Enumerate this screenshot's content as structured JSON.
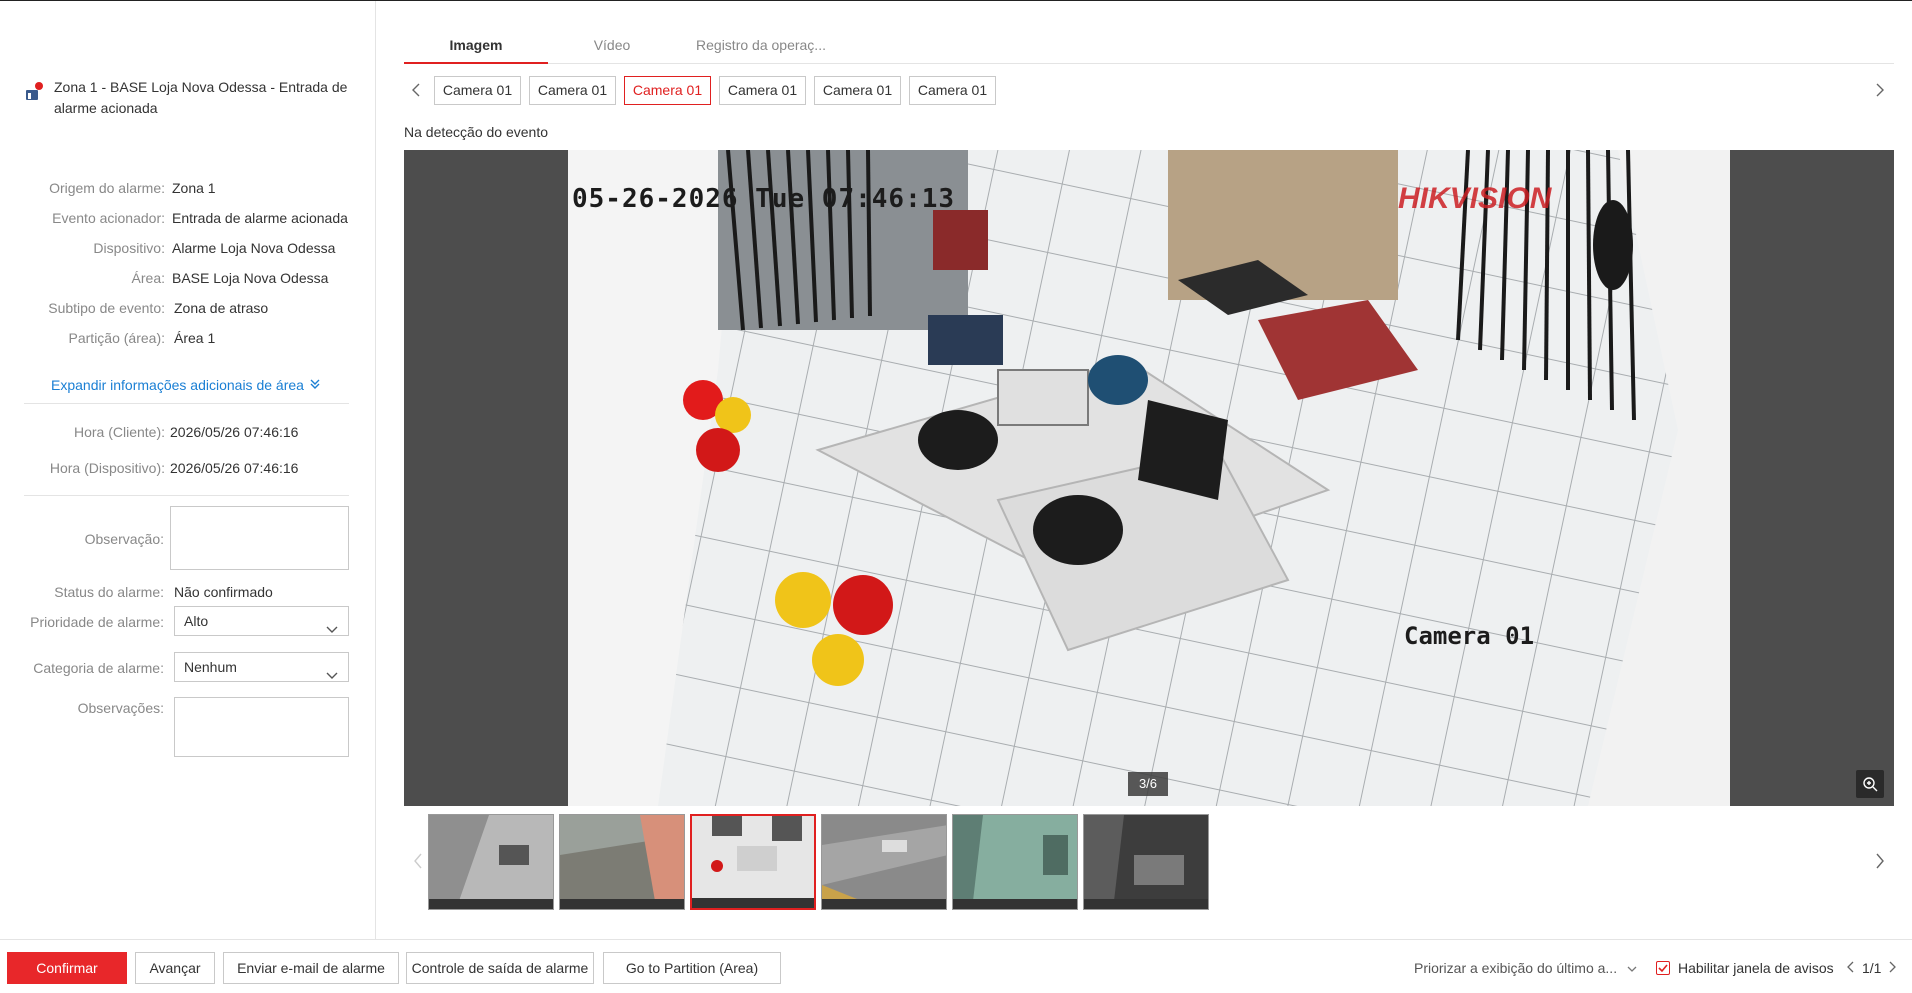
{
  "alarm": {
    "title": "Zona 1 - BASE Loja Nova Odessa - Entrada de alarme acionada"
  },
  "details": [
    {
      "label": "Origem do alarme:",
      "value": "Zona 1"
    },
    {
      "label": "Evento acionador:",
      "value": "Entrada de alarme acionada"
    },
    {
      "label": "Dispositivo:",
      "value": "Alarme Loja Nova Odessa"
    },
    {
      "label": "Área:",
      "value": "BASE Loja Nova Odessa"
    },
    {
      "label": "Subtipo de evento:",
      "value": "Zona de atraso"
    },
    {
      "label": "Partição (área):",
      "value": "Área 1"
    }
  ],
  "expand_label": "Expandir informações adicionais de área",
  "times": [
    {
      "label": "Hora (Cliente):",
      "value": "2026/05/26 07:46:16"
    },
    {
      "label": "Hora (Dispositivo):",
      "value": "2026/05/26 07:46:16"
    }
  ],
  "form": {
    "observation_label": "Observação:",
    "status_label": "Status do alarme:",
    "status_value": "Não confirmado",
    "priority_label": "Prioridade de alarme:",
    "priority_value": "Alto",
    "category_label": "Categoria de alarme:",
    "category_value": "Nenhum",
    "notes_label": "Observações:"
  },
  "tabs": [
    {
      "label": "Imagem",
      "active": true
    },
    {
      "label": "Vídeo",
      "active": false
    },
    {
      "label": "Registro da operaç...",
      "active": false
    }
  ],
  "cameras": [
    "Camera 01",
    "Camera 01",
    "Camera 01",
    "Camera 01",
    "Camera 01",
    "Camera 01"
  ],
  "selected_camera_index": 2,
  "event_label": "Na detecção do evento",
  "image": {
    "osd_time": "05-26-2026 Tue 07:46:13",
    "osd_brand": "HIKVISION",
    "osd_camera": "Camera 01",
    "counter": "3/6"
  },
  "thumbnails_selected_index": 2,
  "colors": {
    "accent": "#e8272a",
    "link": "#1a7fd4"
  },
  "footer": {
    "confirm": "Confirmar",
    "advance": "Avançar",
    "email": "Enviar e-mail de alarme",
    "output": "Controle de saída de alarme",
    "partition": "Go to Partition (Area) Details",
    "prioritize": "Priorizar a exibição do último a...",
    "enable_popup": "Habilitar janela de avisos",
    "page": "1/1"
  }
}
